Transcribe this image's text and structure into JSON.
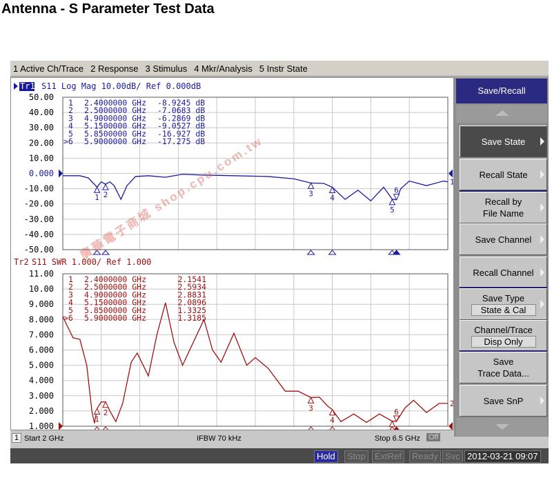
{
  "page_title": "Antenna - S Parameter Test Data",
  "menu": [
    "1 Active Ch/Trace",
    "2 Response",
    "3 Stimulus",
    "4 Mkr/Analysis",
    "5 Instr State"
  ],
  "softkeys": {
    "title": "Save/Recall",
    "items": [
      {
        "label": "Save State",
        "arrow": true,
        "active": true
      },
      {
        "label": "Recall State",
        "arrow": true
      },
      {
        "label": "Recall by\nFile Name",
        "arrow": true
      },
      {
        "label": "Save Channel",
        "arrow": true
      },
      {
        "label": "Recall Channel",
        "arrow": true
      },
      {
        "label": "Save Type",
        "value": "State & Cal",
        "arrow": true
      },
      {
        "label": "Channel/Trace",
        "value": "Disp Only"
      },
      {
        "label": "Save\nTrace Data...",
        "arrow": false
      },
      {
        "label": "Save SnP",
        "arrow": true
      }
    ]
  },
  "status": {
    "channel": "1",
    "start": "Start 2 GHz",
    "ifbw": "IFBW 70 kHz",
    "stop": "Stop 6.5 GHz",
    "off": "Off",
    "indicators": [
      "Hold",
      "Stop",
      "ExtRef",
      "Ready",
      "Svc"
    ],
    "datetime": "2012-03-21 09:07"
  },
  "watermark": "廣華電子商城 shop.cpu.com.tw",
  "colors": {
    "trace1": "#1a1aa0",
    "trace2": "#a01010",
    "accent": "#2a2a80"
  },
  "chart_data": [
    {
      "type": "line",
      "trace": "Tr1",
      "header": "S11 Log Mag 10.00dB/ Ref 0.000dB",
      "ylim": [
        -50,
        50
      ],
      "xlim": [
        2,
        6.5
      ],
      "yticks": [
        "50.00",
        "40.00",
        "30.00",
        "20.00",
        "10.00",
        "0.000",
        "-10.00",
        "-20.00",
        "-30.00",
        "-40.00",
        "-50.00"
      ],
      "ref_label": "0.000",
      "ref_value": 0,
      "grid": true,
      "x": [
        2.0,
        2.2,
        2.3,
        2.4,
        2.45,
        2.5,
        2.55,
        2.6,
        2.68,
        2.75,
        2.85,
        3.0,
        3.2,
        3.4,
        3.6,
        4.0,
        4.4,
        4.7,
        4.9,
        5.05,
        5.15,
        5.3,
        5.45,
        5.6,
        5.75,
        5.85,
        5.9,
        5.95,
        6.05,
        6.25,
        6.45,
        6.5
      ],
      "y": [
        -1.5,
        -1.5,
        -3,
        -8.92,
        -5.5,
        -7.07,
        -5.5,
        -8,
        -17,
        -8,
        -2,
        -1.5,
        -2.5,
        -0.5,
        -1,
        -1.5,
        -2,
        -3.5,
        -6.29,
        -6.5,
        -9.05,
        -17,
        -11,
        -18,
        -9,
        -16.93,
        -17.28,
        -10,
        -5,
        -8,
        -5,
        -5.5
      ],
      "markers": [
        {
          "id": "1",
          "label": "1",
          "freq": 2.4,
          "freq_text": "2.4000000 GHz",
          "value": -8.9245,
          "value_text": "-8.9245 dB"
        },
        {
          "id": "2",
          "label": "2",
          "freq": 2.5,
          "freq_text": "2.5000000 GHz",
          "value": -7.0683,
          "value_text": "-7.0683 dB"
        },
        {
          "id": "3",
          "label": "3",
          "freq": 4.9,
          "freq_text": "4.9000000 GHz",
          "value": -6.2869,
          "value_text": "-6.2869 dB"
        },
        {
          "id": "4",
          "label": "4",
          "freq": 5.15,
          "freq_text": "5.1500000 GHz",
          "value": -9.0527,
          "value_text": "-9.0527 dB"
        },
        {
          "id": "5",
          "label": "5",
          "freq": 5.85,
          "freq_text": "5.8500000 GHz",
          "value": -16.927,
          "value_text": "-16.927 dB"
        },
        {
          "id": "6",
          "label": ">6",
          "freq": 5.9,
          "freq_text": "5.9000000 GHz",
          "value": -17.275,
          "value_text": "-17.275 dB"
        }
      ],
      "end_label": "1"
    },
    {
      "type": "line",
      "trace": "Tr2",
      "header": "S11 SWR 1.000/ Ref 1.000",
      "ylim": [
        1,
        11
      ],
      "xlim": [
        2,
        6.5
      ],
      "yticks": [
        "11.00",
        "10.00",
        "9.000",
        "8.000",
        "7.000",
        "6.000",
        "5.000",
        "4.000",
        "3.000",
        "2.000",
        "1.000"
      ],
      "ref_value": 1,
      "grid": true,
      "x": [
        2.0,
        2.05,
        2.12,
        2.2,
        2.28,
        2.34,
        2.37,
        2.4,
        2.45,
        2.5,
        2.55,
        2.62,
        2.7,
        2.8,
        2.87,
        3.0,
        3.1,
        3.2,
        3.3,
        3.4,
        3.55,
        3.65,
        3.75,
        3.85,
        4.0,
        4.15,
        4.25,
        4.4,
        4.6,
        4.75,
        4.9,
        5.0,
        5.1,
        5.15,
        5.25,
        5.4,
        5.55,
        5.7,
        5.85,
        5.9,
        6.0,
        6.1,
        6.25,
        6.4,
        6.5
      ],
      "y": [
        8.2,
        7.6,
        6.8,
        6.7,
        5.0,
        2.0,
        1.2,
        2.15,
        2.6,
        2.59,
        2.0,
        1.3,
        2.5,
        5.2,
        5.8,
        4.3,
        7.0,
        9.1,
        6.5,
        5.0,
        6.8,
        8.0,
        6.0,
        5.2,
        7.1,
        5.0,
        5.5,
        4.8,
        3.3,
        3.3,
        2.88,
        2.9,
        2.3,
        2.09,
        1.3,
        1.8,
        1.25,
        1.8,
        1.33,
        1.32,
        2.2,
        2.7,
        1.9,
        2.5,
        2.5
      ],
      "markers": [
        {
          "id": "1",
          "label": "1",
          "freq": 2.4,
          "freq_text": "2.4000000 GHz",
          "value": 2.1541,
          "value_text": "2.1541"
        },
        {
          "id": "2",
          "label": "2",
          "freq": 2.5,
          "freq_text": "2.5000000 GHz",
          "value": 2.5934,
          "value_text": "2.5934"
        },
        {
          "id": "3",
          "label": "3",
          "freq": 4.9,
          "freq_text": "4.9000000 GHz",
          "value": 2.8831,
          "value_text": "2.8831"
        },
        {
          "id": "4",
          "label": "4",
          "freq": 5.15,
          "freq_text": "5.1500000 GHz",
          "value": 2.0896,
          "value_text": "2.0896"
        },
        {
          "id": "5",
          "label": "5",
          "freq": 5.85,
          "freq_text": "5.8500000 GHz",
          "value": 1.3325,
          "value_text": "1.3325"
        },
        {
          "id": "6",
          "label": ">6",
          "freq": 5.9,
          "freq_text": "5.9000000 GHz",
          "value": 1.3185,
          "value_text": "1.3185"
        }
      ],
      "end_label": "2"
    }
  ]
}
